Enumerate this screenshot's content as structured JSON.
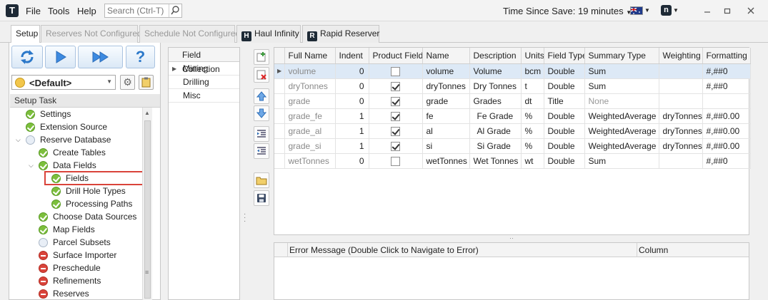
{
  "menu": {
    "file": "File",
    "tools": "Tools",
    "help": "Help"
  },
  "search": {
    "placeholder": "Search (Ctrl-T)"
  },
  "status": {
    "time_since_save": "Time Since Save: 19 minutes"
  },
  "tabs": [
    {
      "label": "Setup"
    },
    {
      "label": "Reserves Not Configured"
    },
    {
      "label": "Schedule Not Configured"
    },
    {
      "label": "Haul Infinity"
    },
    {
      "label": "Rapid Reserver"
    }
  ],
  "profile": {
    "selected": "<Default>"
  },
  "setup_task": {
    "header": "Setup Task",
    "items": [
      {
        "label": "Settings",
        "state": "ok"
      },
      {
        "label": "Extension Source",
        "state": "ok"
      },
      {
        "label": "Reserve Database",
        "state": "none"
      },
      {
        "label": "Create Tables",
        "state": "ok"
      },
      {
        "label": "Data Fields",
        "state": "ok"
      },
      {
        "label": "Fields",
        "state": "ok"
      },
      {
        "label": "Drill Hole Types",
        "state": "ok"
      },
      {
        "label": "Processing Paths",
        "state": "ok"
      },
      {
        "label": "Choose Data Sources",
        "state": "ok"
      },
      {
        "label": "Map Fields",
        "state": "ok"
      },
      {
        "label": "Parcel Subsets",
        "state": "none"
      },
      {
        "label": "Surface Importer",
        "state": "err"
      },
      {
        "label": "Preschedule",
        "state": "err"
      },
      {
        "label": "Refinements",
        "state": "err"
      },
      {
        "label": "Reserves",
        "state": "err"
      }
    ]
  },
  "field_collection": {
    "header": "Field Collection",
    "items": [
      "Mining",
      "Drilling",
      "Misc"
    ]
  },
  "grid": {
    "columns": [
      "Full Name",
      "Indent",
      "Product Field",
      "Name",
      "Description",
      "Units",
      "Field Type",
      "Summary Type",
      "Weighting",
      "Formatting"
    ],
    "rows": [
      {
        "full_name": "volume",
        "indent": "0",
        "product": false,
        "name": "volume",
        "description": "Volume",
        "units": "bcm",
        "field_type": "Double",
        "summary_type": "Sum",
        "weighting": "",
        "formatting": "#,##0"
      },
      {
        "full_name": "dryTonnes",
        "indent": "0",
        "product": true,
        "name": "dryTonnes",
        "description": "Dry Tonnes",
        "units": "t",
        "field_type": "Double",
        "summary_type": "Sum",
        "weighting": "",
        "formatting": "#,##0"
      },
      {
        "full_name": "grade",
        "indent": "0",
        "product": true,
        "name": "grade",
        "description": "Grades",
        "units": "dt",
        "field_type": "Title",
        "summary_type": "None",
        "weighting": "",
        "formatting": ""
      },
      {
        "full_name": "grade_fe",
        "indent": "1",
        "product": true,
        "name": "fe",
        "description": "Fe Grade",
        "units": "%",
        "field_type": "Double",
        "summary_type": "WeightedAverage",
        "weighting": "dryTonnes",
        "formatting": "#,##0.00"
      },
      {
        "full_name": "grade_al",
        "indent": "1",
        "product": true,
        "name": "al",
        "description": "Al Grade",
        "units": "%",
        "field_type": "Double",
        "summary_type": "WeightedAverage",
        "weighting": "dryTonnes",
        "formatting": "#,##0.00"
      },
      {
        "full_name": "grade_si",
        "indent": "1",
        "product": true,
        "name": "si",
        "description": "Si Grade",
        "units": "%",
        "field_type": "Double",
        "summary_type": "WeightedAverage",
        "weighting": "dryTonnes",
        "formatting": "#,##0.00"
      },
      {
        "full_name": "wetTonnes",
        "indent": "0",
        "product": false,
        "name": "wetTonnes",
        "description": "Wet Tonnes",
        "units": "wt",
        "field_type": "Double",
        "summary_type": "Sum",
        "weighting": "",
        "formatting": "#,##0"
      }
    ]
  },
  "errors": {
    "col_message": "Error Message (Double Click to Navigate to Error)",
    "col_column": "Column"
  },
  "colors": {
    "accent": "#d9433a",
    "selection": "#dde9f6",
    "ok": "#7cbf3c"
  }
}
